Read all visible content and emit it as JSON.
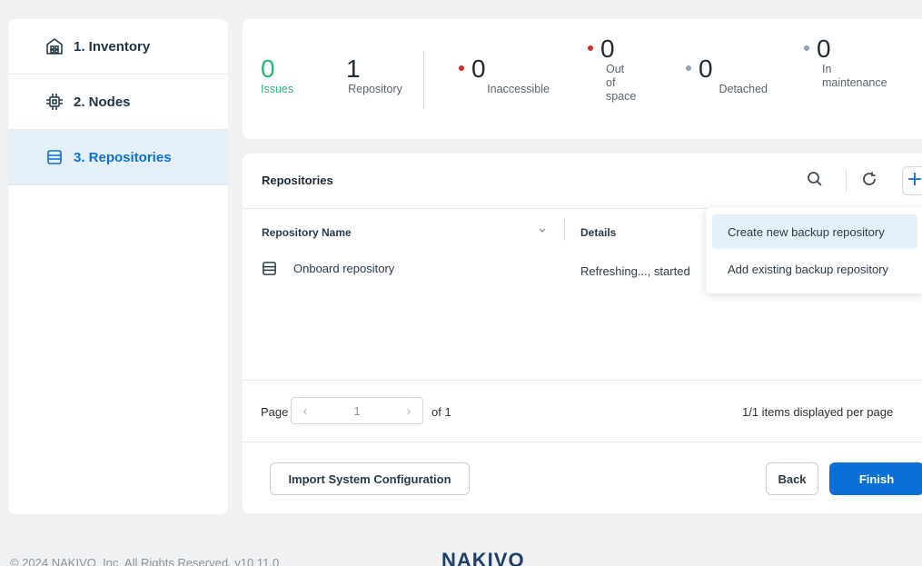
{
  "sidebar": {
    "items": [
      {
        "label": "1. Inventory",
        "icon": "inventory-icon"
      },
      {
        "label": "2. Nodes",
        "icon": "node-chip-icon"
      },
      {
        "label": "3. Repositories",
        "icon": "repository-icon"
      }
    ]
  },
  "summary": {
    "issues": {
      "value": "0",
      "label": "Issues"
    },
    "repository": {
      "value": "1",
      "label": "Repository"
    },
    "inaccessible": {
      "value": "0",
      "label": "Inaccessible"
    },
    "out_of_space": {
      "value": "0",
      "label_lines": [
        "Out",
        "of",
        "space"
      ]
    },
    "detached": {
      "value": "0",
      "label": "Detached"
    },
    "in_maintenance": {
      "value": "0",
      "label_lines": [
        "In",
        "maintenance"
      ]
    }
  },
  "repositories": {
    "title": "Repositories",
    "columns": {
      "name": "Repository Name",
      "details": "Details"
    },
    "rows": [
      {
        "name": "Onboard repository",
        "details": "Refreshing..., started"
      }
    ],
    "pager": {
      "page_label": "Page",
      "page": "1",
      "of_label": "of 1",
      "items_info": "1/1 items displayed per page"
    }
  },
  "menu": {
    "items": [
      "Create new backup repository",
      "Add existing backup repository"
    ]
  },
  "buttons": {
    "import": "Import System Configuration",
    "back": "Back",
    "finish": "Finish"
  },
  "footer": {
    "copyright": "© 2024 NAKIVO, Inc. All Rights Reserved. v10.11.0",
    "logo": "NAKIVO"
  },
  "colors": {
    "accent": "#0a6fd6",
    "issues_green": "#2bb673",
    "red_dot": "#d9262b",
    "grey_dot": "#8fa4b8"
  }
}
